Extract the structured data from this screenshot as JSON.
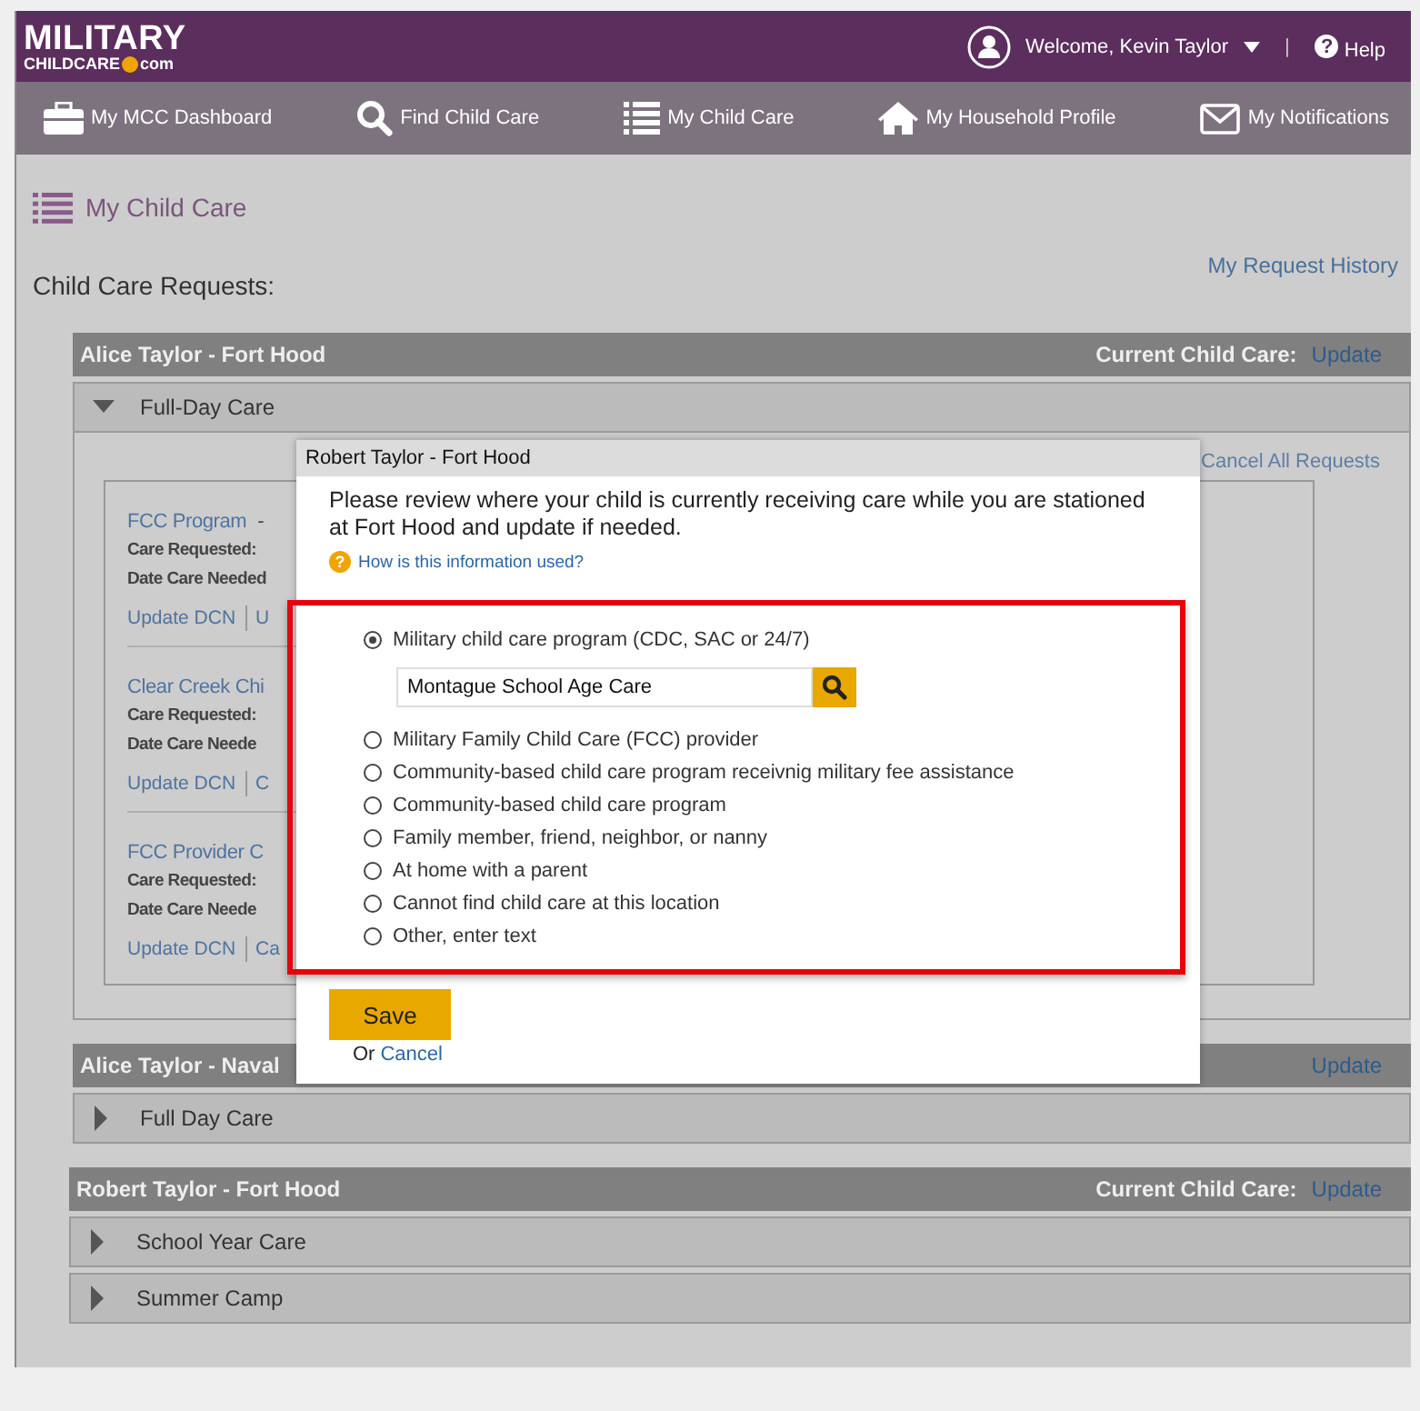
{
  "header": {
    "logo_top": "MILITARY",
    "logo_bottom": "CHILDCARE",
    "logo_suffix": "com",
    "welcome": "Welcome, Kevin Taylor",
    "separator": "|",
    "help_glyph": "?",
    "help": "Help"
  },
  "nav": [
    {
      "label": "My MCC Dashboard",
      "kind": "briefcase"
    },
    {
      "label": "Find Child Care",
      "kind": "search"
    },
    {
      "label": "My Child Care",
      "kind": "list"
    },
    {
      "label": "My Household Profile",
      "kind": "house"
    },
    {
      "label": "My Notifications",
      "kind": "envelope"
    }
  ],
  "page_title": "My Child Care",
  "section_title": "Child Care Requests:",
  "history_link": "My Request History",
  "groups": [
    {
      "title": "Alice Taylor - Fort Hood",
      "current_label": "Current Child Care:",
      "update": "Update",
      "cancel_all": "Cancel All Requests",
      "rows": [
        {
          "label": "Full-Day Care",
          "expanded": true
        }
      ],
      "requests": [
        {
          "title": "FCC Program",
          "dash": "-",
          "care_label": "Care Requested:",
          "date_label": "Date Care Needed",
          "link": "Update DCN",
          "link_2": "U"
        },
        {
          "title": "Clear Creek Chi",
          "care_label": "Care Requested:",
          "date_label": "Date Care Neede",
          "link": "Update DCN",
          "link_2": "C"
        },
        {
          "title": "FCC Provider C",
          "care_label": "Care Requested:",
          "date_label": "Date Care Neede",
          "link": "Update DCN",
          "link_2": "Ca"
        }
      ]
    },
    {
      "title": "Alice Taylor - Naval",
      "update": "Update",
      "rows": [
        {
          "label": "Full Day Care",
          "expanded": false
        }
      ]
    },
    {
      "title": "Robert Taylor  - Fort Hood",
      "current_label": "Current Child Care:",
      "update": "Update",
      "rows": [
        {
          "label": "School Year Care",
          "expanded": false
        },
        {
          "label": "Summer Camp",
          "expanded": false
        }
      ]
    }
  ],
  "dialog": {
    "title": "Robert Taylor - Fort Hood",
    "intro": "Please review where your child is currently receiving care while you are stationed at Fort Hood and update if needed.",
    "help_glyph": "?",
    "help_link": "How is this information used?",
    "options": [
      {
        "label": "Military child care program (CDC, SAC or 24/7)",
        "selected": true
      },
      {
        "label": "Military Family Child Care (FCC) provider",
        "selected": false
      },
      {
        "label": "Community-based child care program receivnig military fee assistance",
        "selected": false
      },
      {
        "label": "Community-based child care program",
        "selected": false
      },
      {
        "label": "Family member, friend, neighbor, or nanny",
        "selected": false
      },
      {
        "label": "At home with a parent",
        "selected": false
      },
      {
        "label": "Cannot find child care at this location",
        "selected": false
      },
      {
        "label": "Other, enter text",
        "selected": false
      }
    ],
    "search_value": "Montague School Age Care",
    "save": "Save",
    "or": "Or",
    "cancel": "Cancel"
  }
}
